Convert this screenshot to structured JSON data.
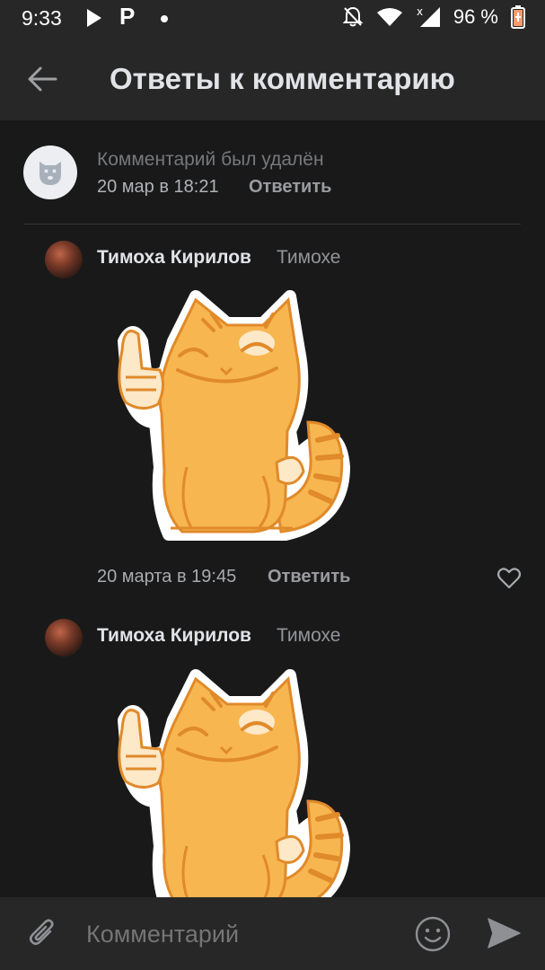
{
  "status_bar": {
    "time": "9:33",
    "app_icon": "P",
    "battery": "96 %"
  },
  "header": {
    "title": "Ответы к комментарию",
    "back_icon": "arrow-left-icon"
  },
  "root_comment": {
    "text": "Комментарий был удалён",
    "date": "20 мар в 18:21",
    "reply_label": "Ответить"
  },
  "replies": [
    {
      "author": "Тимоха Кирилов",
      "reply_to": "Тимохе",
      "sticker": "cat-thumbs-up-sticker",
      "date": "20 марта в 19:45",
      "reply_label": "Ответить"
    },
    {
      "author": "Тимоха Кирилов",
      "reply_to": "Тимохе",
      "sticker": "cat-thumbs-up-sticker"
    }
  ],
  "composer": {
    "placeholder": "Комментарий"
  },
  "colors": {
    "background": "#19191a",
    "bar": "#272727",
    "sticker_fill": "#f7b650",
    "sticker_stroke": "#e08a2a"
  }
}
